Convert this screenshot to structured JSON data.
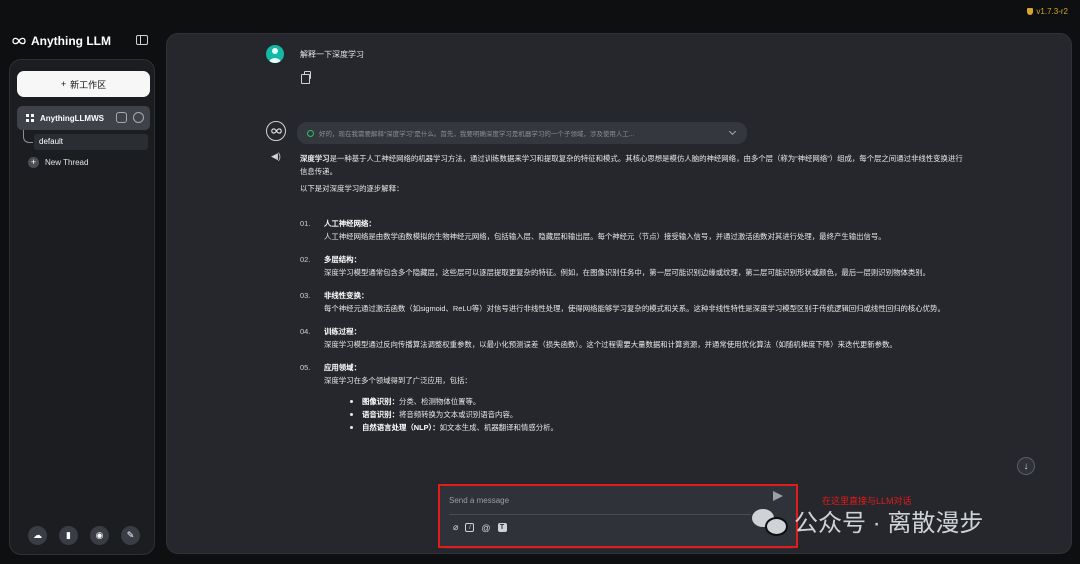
{
  "app": {
    "version": "v1.7.3-r2",
    "brand": "Anything LLM"
  },
  "sidebar": {
    "new_workspace_label": "新工作区",
    "workspace": {
      "name": "AnythingLLMWS",
      "threads": [
        {
          "label": "default"
        }
      ],
      "new_thread_label": "New Thread"
    },
    "bottom_icons": [
      "community-hub-icon",
      "docs-book-icon",
      "discord-icon",
      "settings-wrench-icon"
    ]
  },
  "chat": {
    "user_message": "解释一下深度学习",
    "thought_summary": "好的，现在我需要解释“深度学习”是什么。首先，我要明确深度学习是机器学习的一个子领域，涉及使用人工...",
    "answer": {
      "intro_bold": "深度学习",
      "intro_rest": "是一种基于人工神经网络的机器学习方法，通过训练数据来学习和提取复杂的特征和模式。其核心思想是模仿人脑的神经网络，由多个层（称为“神经网络”）组成，每个层之间通过非线性变换进行信息传递。",
      "lead": "以下是对深度学习的逐步解释：",
      "items": [
        {
          "num": "01.",
          "title": "人工神经网络：",
          "body": "人工神经网络是由数学函数模拟的生物神经元网络，包括输入层、隐藏层和输出层。每个神经元（节点）接受输入信号，并通过激活函数对其进行处理，最终产生输出信号。"
        },
        {
          "num": "02.",
          "title": "多层结构：",
          "body": "深度学习模型通常包含多个隐藏层，这些层可以逐层提取更复杂的特征。例如，在图像识别任务中，第一层可能识别边缘或纹理，第二层可能识别形状或颜色，最后一层则识别物体类别。"
        },
        {
          "num": "03.",
          "title": "非线性变换：",
          "body": "每个神经元通过激活函数（如sigmoid、ReLU等）对信号进行非线性处理，使得网络能够学习复杂的模式和关系。这种非线性特性是深度学习模型区别于传统逻辑回归或线性回归的核心优势。"
        },
        {
          "num": "04.",
          "title": "训练过程：",
          "body": "深度学习模型通过反向传播算法调整权重参数，以最小化预测误差（损失函数）。这个过程需要大量数据和计算资源，并通常使用优化算法（如随机梯度下降）来迭代更新参数。"
        },
        {
          "num": "05.",
          "title": "应用领域：",
          "body": "深度学习在多个领域得到了广泛应用，包括："
        }
      ],
      "bullets": [
        {
          "bold": "图像识别：",
          "text": "分类、检测物体位置等。"
        },
        {
          "bold": "语音识别：",
          "text": "将音频转换为文本或识别语音内容。"
        },
        {
          "bold": "自然语言处理（NLP）：",
          "text": "如文本生成、机器翻译和情感分析。"
        }
      ]
    }
  },
  "composer": {
    "placeholder": "Send a message"
  },
  "annotation": {
    "text": "在这里直接与LLM对话",
    "color": "#e31b1b"
  },
  "watermark": {
    "text": "公众号 · 离散漫步"
  },
  "colors": {
    "accent_user": "#14b8a6",
    "version_gold": "#d6a52a",
    "background": "#0e0f11",
    "chat_panel": "#25272c"
  }
}
